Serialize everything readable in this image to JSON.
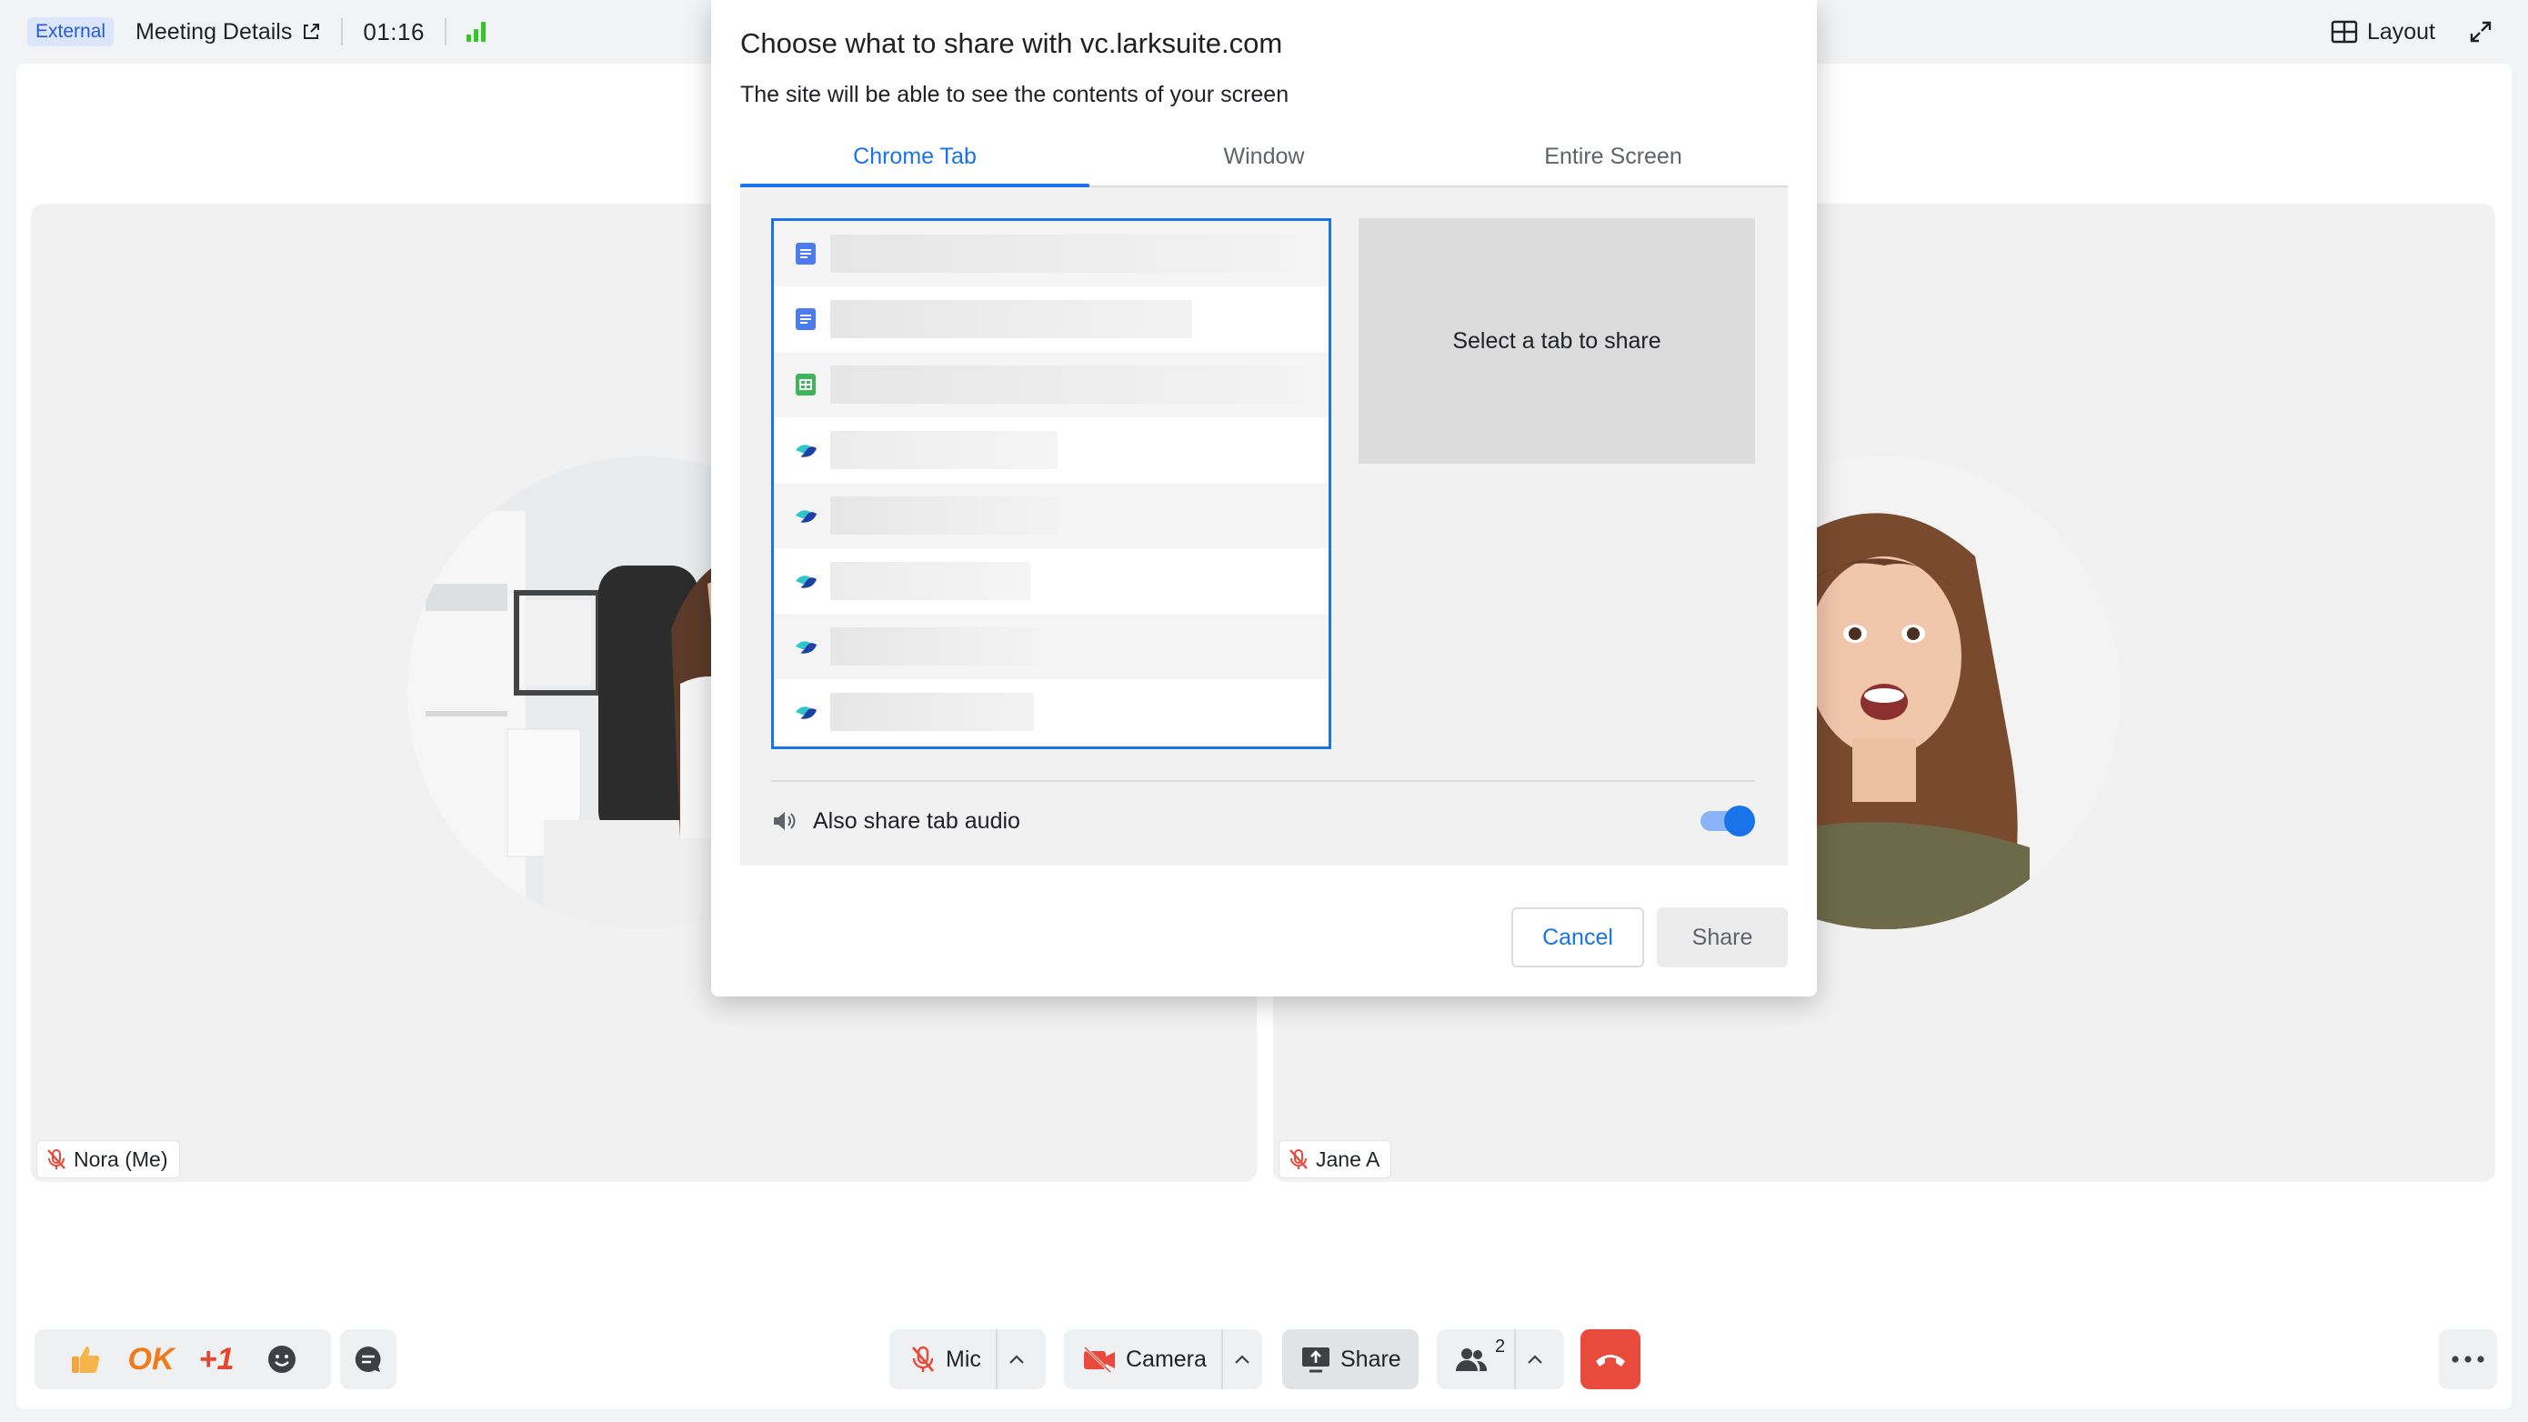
{
  "topbar": {
    "badge": "External",
    "meeting_details": "Meeting Details",
    "timer": "01:16",
    "layout_label": "Layout"
  },
  "participants": [
    {
      "name": "Nora (Me)",
      "mic": "muted"
    },
    {
      "name": "Jane A",
      "mic": "muted"
    }
  ],
  "toolbar": {
    "reactions": {
      "ok": "OK",
      "plus_one": "+1"
    },
    "mic_label": "Mic",
    "camera_label": "Camera",
    "share_label": "Share",
    "participant_count": "2"
  },
  "dialog": {
    "title": "Choose what to share with vc.larksuite.com",
    "subtitle": "The site will be able to see the contents of your screen",
    "tabs": [
      {
        "label": "Chrome Tab",
        "active": true
      },
      {
        "label": "Window",
        "active": false
      },
      {
        "label": "Entire Screen",
        "active": false
      }
    ],
    "tab_list": [
      {
        "icon": "docs-icon"
      },
      {
        "icon": "docs-icon"
      },
      {
        "icon": "sheets-icon"
      },
      {
        "icon": "lark-icon"
      },
      {
        "icon": "lark-icon"
      },
      {
        "icon": "lark-icon"
      },
      {
        "icon": "lark-icon"
      },
      {
        "icon": "lark-icon"
      }
    ],
    "preview_text": "Select a tab to share",
    "audio_label": "Also share tab audio",
    "audio_enabled": true,
    "cancel_label": "Cancel",
    "share_label": "Share"
  },
  "colors": {
    "accent": "#1a73e8",
    "external_badge_bg": "#dbe6fd",
    "hangup": "#e84a3c",
    "signal": "#34c724"
  }
}
